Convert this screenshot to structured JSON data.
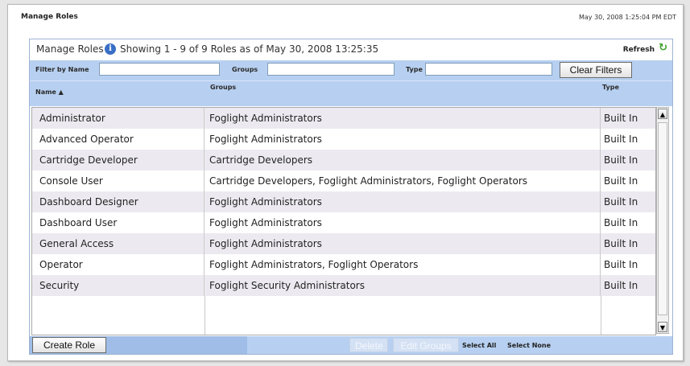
{
  "page": {
    "title": "Manage Roles",
    "timestamp": "May 30, 2008 1:25:04 PM EDT"
  },
  "panel": {
    "title": "Manage Roles",
    "showing": "Showing 1 - 9  of 9 Roles as of May 30, 2008 13:25:35",
    "refresh_label": "Refresh"
  },
  "filters": {
    "name_label": "Filter by Name",
    "name_value": "",
    "groups_label": "Groups",
    "groups_value": "",
    "type_label": "Type",
    "type_value": "",
    "clear_label": "Clear Filters"
  },
  "table": {
    "columns": [
      "Name ▲",
      "Groups",
      "Type"
    ],
    "rows": [
      {
        "name": "Administrator",
        "groups": "Foglight Administrators",
        "type": "Built In"
      },
      {
        "name": "Advanced Operator",
        "groups": "Foglight Administrators",
        "type": "Built In"
      },
      {
        "name": "Cartridge Developer",
        "groups": "Cartridge Developers",
        "type": "Built In"
      },
      {
        "name": "Console User",
        "groups": "Cartridge Developers, Foglight Administrators, Foglight Operators",
        "type": "Built In"
      },
      {
        "name": "Dashboard Designer",
        "groups": "Foglight Administrators",
        "type": "Built In"
      },
      {
        "name": "Dashboard User",
        "groups": "Foglight Administrators",
        "type": "Built In"
      },
      {
        "name": "General Access",
        "groups": "Foglight Administrators",
        "type": "Built In"
      },
      {
        "name": "Operator",
        "groups": "Foglight Administrators, Foglight Operators",
        "type": "Built In"
      },
      {
        "name": "Security",
        "groups": "Foglight Security Administrators",
        "type": "Built In"
      }
    ]
  },
  "footer": {
    "create_label": "Create Role",
    "delete_label": "Delete",
    "edit_groups_label": "Edit Groups",
    "select_all_label": "Select All",
    "select_none_label": "Select None"
  },
  "icons": {
    "info": "info-icon",
    "refresh": "refresh-icon",
    "scroll_up": "scroll-up-arrow-icon",
    "scroll_down": "scroll-down-arrow-icon"
  },
  "colors": {
    "header_band": "#b7d0f1",
    "footer_dark": "#9fbde6",
    "info_icon": "#3a6fc6",
    "refresh_icon": "#3fa02d"
  }
}
